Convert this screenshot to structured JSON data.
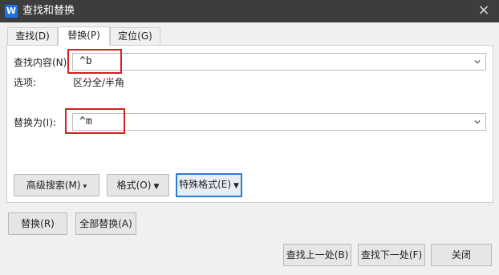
{
  "window": {
    "title": "查找和替换",
    "close_icon": "×"
  },
  "tabs": [
    {
      "label": "查找(D)"
    },
    {
      "label": "替换(P)"
    },
    {
      "label": "定位(G)"
    }
  ],
  "find": {
    "label": "查找内容(N):",
    "value": "^b"
  },
  "options": {
    "label": "选项:",
    "value": "区分全/半角"
  },
  "replace": {
    "label": "替换为(I):",
    "value": "^m"
  },
  "panel_buttons": {
    "advanced": "高级搜索(M)",
    "format": "格式(O)",
    "special": "特殊格式(E)"
  },
  "action_buttons": {
    "replace": "替换(R)",
    "replace_all": "全部替换(A)",
    "find_prev": "查找上一处(B)",
    "find_next": "查找下一处(F)",
    "close": "关闭"
  },
  "colors": {
    "highlight": "#d81e1e",
    "focus": "#2b7bd8",
    "titlebar": "#3d3d3d"
  }
}
